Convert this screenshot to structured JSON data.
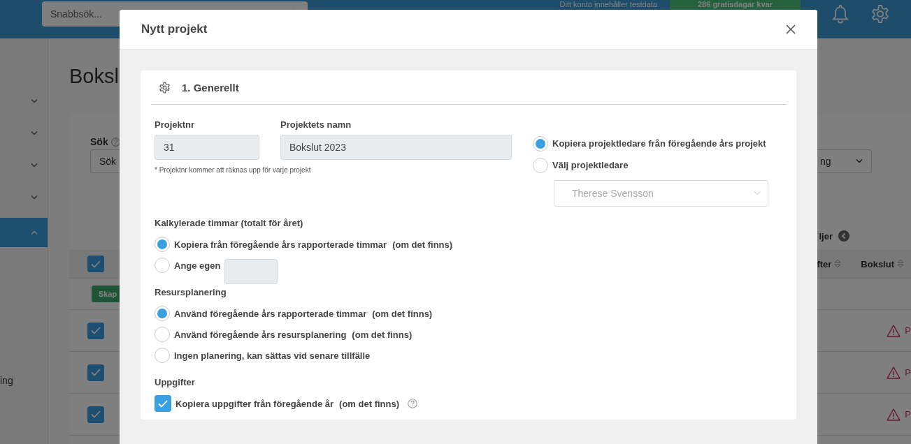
{
  "topbar": {
    "search_placeholder": "Snabbsök...",
    "notice": "Ditt konto innehåller testdata",
    "trial_badge": "286 gratisdagar kvar"
  },
  "sidebar": {
    "items": [
      {
        "expanded": false,
        "selected": false
      },
      {
        "expanded": false,
        "selected": false
      },
      {
        "expanded": false,
        "selected": false
      },
      {
        "expanded": false,
        "selected": false
      },
      {
        "expanded": true,
        "selected": true
      }
    ],
    "partial_label": "ing"
  },
  "page": {
    "title": "Boksl",
    "search_label": "Sök",
    "search_value": "Sök",
    "filter_value": "ng",
    "details_toggle": "ljer"
  },
  "table": {
    "select_all_checked": true,
    "columns": [
      "fter",
      "Bokslut"
    ],
    "create_button": "Skap",
    "rows": [
      {
        "checked": true,
        "status": "P"
      },
      {
        "checked": true,
        "status": "P"
      },
      {
        "checked": true,
        "status": "P"
      }
    ]
  },
  "modal": {
    "title": "Nytt projekt",
    "section_title": "1. Generellt",
    "project_number": {
      "label": "Projektnr",
      "value": "31",
      "note": "* Projektnr kommer att räknas upp för varje projekt"
    },
    "project_name": {
      "label": "Projektets namn",
      "value": "Bokslut 2023"
    },
    "project_leader": {
      "options": [
        {
          "label": "Kopiera projektledare från föregående års projekt",
          "selected": true
        },
        {
          "label": "Välj projektledare",
          "selected": false
        }
      ],
      "select_value": "Therese Svensson",
      "disabled": true
    },
    "hours": {
      "title": "Kalkylerade timmar (totalt för året)",
      "options": [
        {
          "kind": "text",
          "label": "Kopiera från föregående års rapporterade timmar",
          "note": "(om det finns)",
          "selected": true
        },
        {
          "kind": "input",
          "label": "Ange egen",
          "selected": false
        }
      ]
    },
    "resource_planning": {
      "title": "Resursplanering",
      "options": [
        {
          "kind": "text",
          "label": "Använd föregående års rapporterade timmar",
          "note": "(om det finns)",
          "selected": true
        },
        {
          "kind": "text",
          "label": "Använd föregående års resursplanering",
          "note": "(om det finns)",
          "selected": false
        },
        {
          "kind": "text",
          "label": "Ingen planering, kan sättas vid senare tillfälle",
          "selected": false
        }
      ]
    },
    "tasks": {
      "title": "Uppgifter",
      "label": "Kopiera uppgifter från föregående år",
      "note": "(om det finns)",
      "checked": true
    }
  }
}
